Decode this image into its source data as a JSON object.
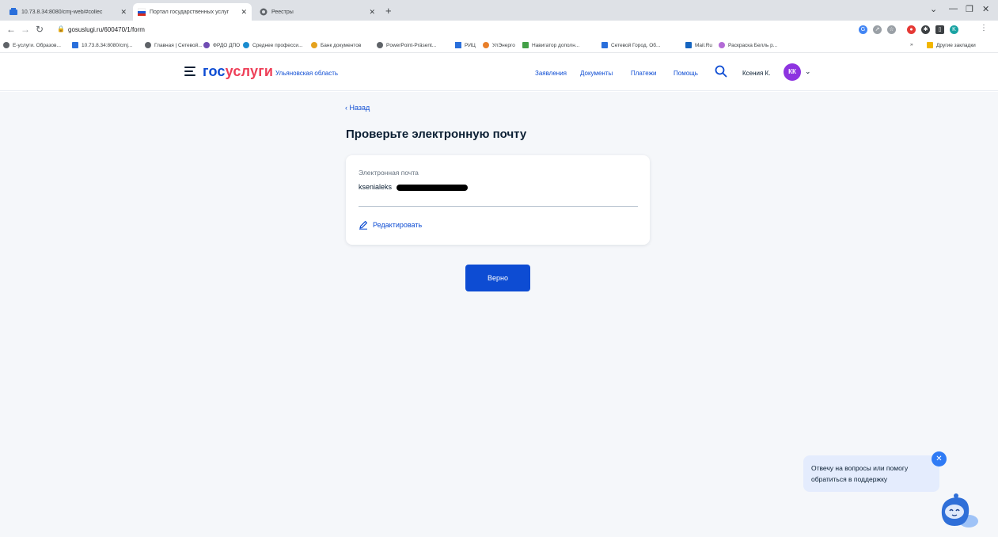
{
  "browser": {
    "tabs": [
      {
        "title": "10.73.8.34:8080/cmj-web/#collec",
        "active": false
      },
      {
        "title": "Портал государственных услуг",
        "active": true
      },
      {
        "title": "Реестры",
        "active": false
      }
    ],
    "url": "gosuslugi.ru/600470/1/form",
    "bookmarks": [
      "Е-услуги. Образов...",
      "10.73.8.34:8080/cmj...",
      "Главная | Сетевой...",
      "ФРДО ДПО",
      "Среднее професси...",
      "Банк документов",
      "PowerPoint-Präsent...",
      "РИЦ",
      "УлЭнерго",
      "Навигатор дополн...",
      "Сетевой Город. Об...",
      "Mail.Ru",
      "Раскраска Белль р..."
    ],
    "bookmarks_overflow": "»",
    "other_bookmarks": "Другие закладки",
    "profile_initial": "K"
  },
  "header": {
    "logo_part1": "гос",
    "logo_part2": "услуги",
    "region": "Ульяновская область",
    "nav": [
      "Заявления",
      "Документы",
      "Платежи",
      "Помощь"
    ],
    "user_name": "Ксения К.",
    "avatar_initials": "КК"
  },
  "main": {
    "back_label": "‹ Назад",
    "title": "Проверьте электронную почту",
    "field_label": "Электронная почта",
    "field_value": "ksenialeks",
    "edit_label": "Редактировать",
    "confirm_label": "Верно"
  },
  "chat": {
    "message": "Отвечу на вопросы или помогу обратиться в поддержку"
  },
  "colors": {
    "brand_blue": "#0d4cd3",
    "brand_red": "#ee3f58",
    "avatar": "#8d33e0",
    "page_bg": "#f5f7fa"
  }
}
